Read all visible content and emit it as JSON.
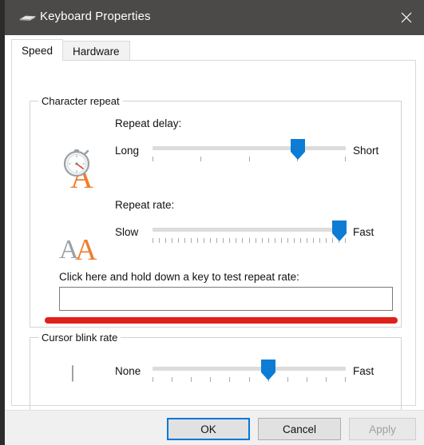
{
  "window": {
    "title": "Keyboard Properties",
    "icon": "keyboard-icon",
    "close_label": "×",
    "titlebar_color": "#4c4a48"
  },
  "tabs": [
    {
      "label": "Speed",
      "active": true
    },
    {
      "label": "Hardware",
      "active": false
    }
  ],
  "groups": {
    "character_repeat": {
      "title": "Character repeat",
      "repeat_delay": {
        "label": "Repeat delay:",
        "icon": "stopwatch-letter-a-icon",
        "left_label": "Long",
        "right_label": "Short",
        "ticks": 5,
        "value": 3,
        "max": 4
      },
      "repeat_rate": {
        "label": "Repeat rate:",
        "icon": "double-a-icon",
        "left_label": "Slow",
        "right_label": "Fast",
        "ticks": 31,
        "value": 30,
        "max": 31
      },
      "test": {
        "label": "Click here and hold down a key to test repeat rate:",
        "value": "",
        "placeholder": ""
      },
      "annotation": {
        "type": "red-underline",
        "color": "#e0201b"
      }
    },
    "cursor_blink_rate": {
      "title": "Cursor blink rate",
      "icon": "text-caret-icon",
      "caret_glyph": "|",
      "left_label": "None",
      "right_label": "Fast",
      "ticks": 11,
      "value": 6,
      "max": 10
    }
  },
  "footer": {
    "ok_label": "OK",
    "cancel_label": "Cancel",
    "apply_label": "Apply",
    "accent_color": "#0078d7"
  }
}
